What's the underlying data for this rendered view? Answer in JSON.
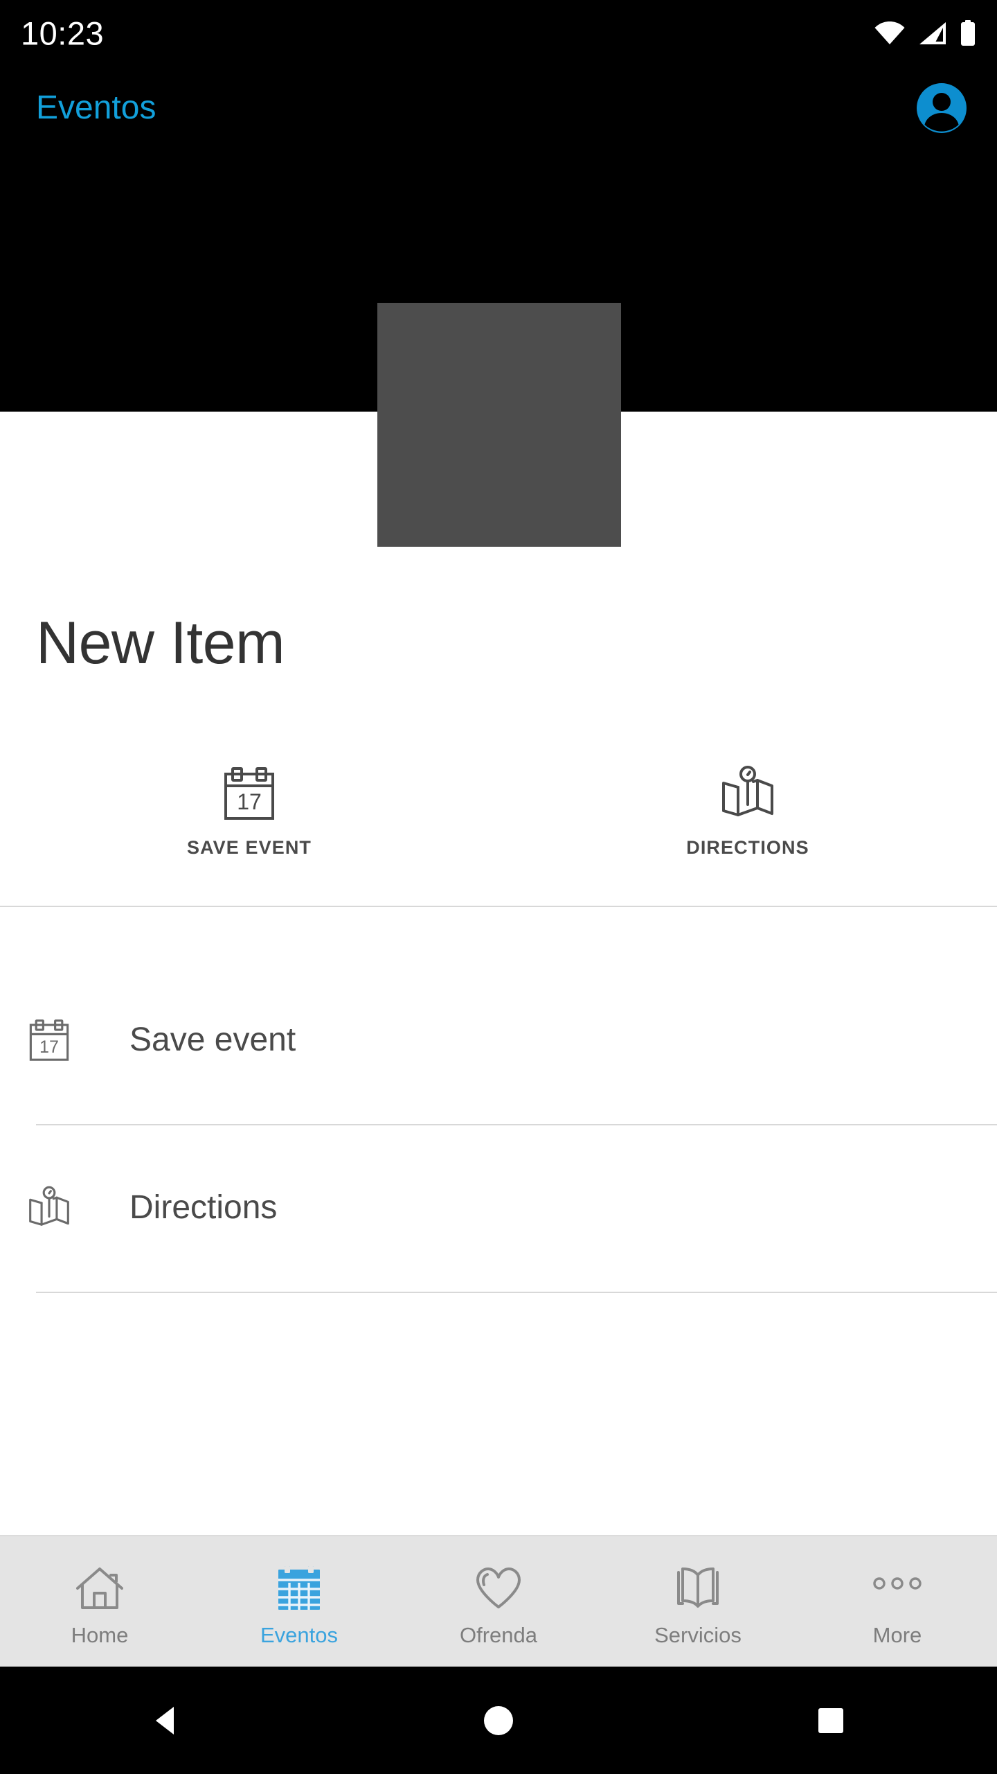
{
  "status_bar": {
    "time": "10:23",
    "icons": [
      "wifi-icon",
      "cellular-signal-icon",
      "battery-icon"
    ]
  },
  "app_bar": {
    "title": "Eventos",
    "title_color": "#12a0db",
    "avatar_icon": "account-circle-icon",
    "background": "#000000"
  },
  "hero": {
    "placeholder_color": "#4d4d4d",
    "band_color": "#000000"
  },
  "detail": {
    "title": "New Item"
  },
  "quick_actions": [
    {
      "label": "SAVE EVENT",
      "icon": "calendar-17-icon"
    },
    {
      "label": "DIRECTIONS",
      "icon": "map-pin-icon"
    }
  ],
  "list_rows": [
    {
      "label": "Save event",
      "icon": "calendar-17-icon"
    },
    {
      "label": "Directions",
      "icon": "map-pin-icon"
    }
  ],
  "bottom_nav": {
    "active_color": "#3aa3de",
    "inactive_color": "#7d7d7d",
    "items": [
      {
        "label": "Home",
        "icon": "home-icon",
        "active": false
      },
      {
        "label": "Eventos",
        "icon": "calendar-grid-icon",
        "active": true
      },
      {
        "label": "Ofrenda",
        "icon": "heart-icon",
        "active": false
      },
      {
        "label": "Servicios",
        "icon": "open-book-icon",
        "active": false
      },
      {
        "label": "More",
        "icon": "more-dots-icon",
        "active": false
      }
    ]
  },
  "system_nav": {
    "buttons": [
      "back-icon",
      "home-circle-icon",
      "recents-square-icon"
    ]
  }
}
